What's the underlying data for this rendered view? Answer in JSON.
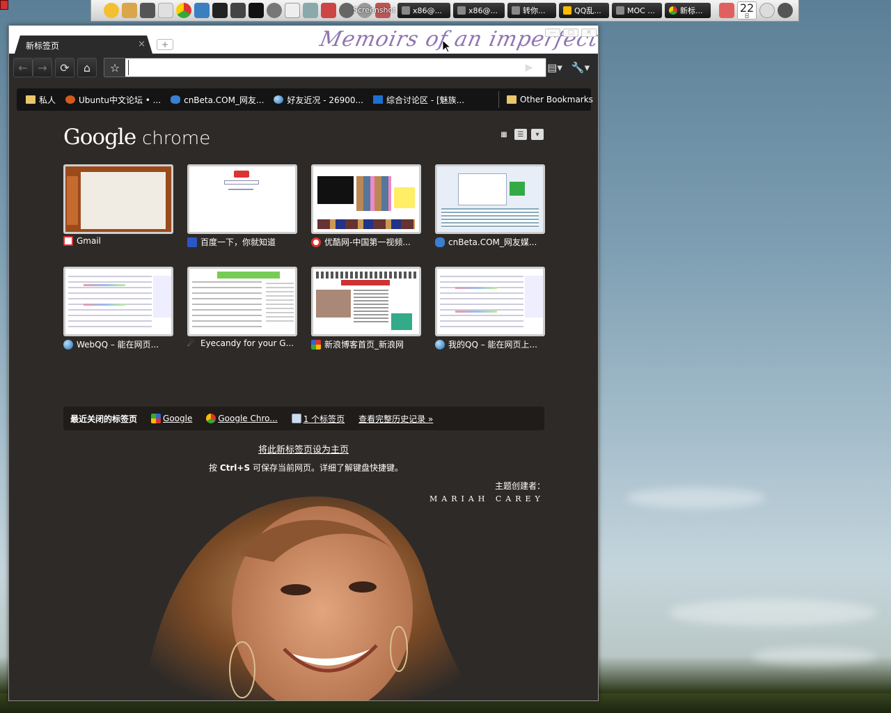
{
  "desktop": {
    "panel": {
      "screenshot_label": "Screenshot",
      "tasks": [
        {
          "label": "x86@..."
        },
        {
          "label": "x86@..."
        },
        {
          "label": "转你..."
        },
        {
          "label": "QQ乱..."
        },
        {
          "label": "MOC ..."
        },
        {
          "label": "新标..."
        }
      ],
      "clock_day": "22",
      "clock_unit": "日"
    }
  },
  "browser": {
    "tab_title": "新标签页",
    "tab_close": "×",
    "newtab_symbol": "+",
    "theme_script": "Memoirs of an imperfect",
    "address_value": "",
    "bookmarks": [
      {
        "label": "私人",
        "icon": "folder-icon"
      },
      {
        "label": "Ubuntu中文论坛 • ...",
        "icon": "ubuntu-icon"
      },
      {
        "label": "cnBeta.COM_网友...",
        "icon": "cnbeta-icon"
      },
      {
        "label": "好友近况 - 26900...",
        "icon": "globe-icon"
      },
      {
        "label": "综合讨论区 - [魅族...",
        "icon": "meizu-icon"
      }
    ],
    "other_bookmarks": "Other Bookmarks",
    "logo_google": "Google",
    "logo_chrome": "chrome",
    "thumbnails": [
      {
        "title": "Gmail",
        "icon": "gmail-icon"
      },
      {
        "title": "百度一下，你就知道",
        "icon": "baidu-icon"
      },
      {
        "title": "优酷网-中国第一视频...",
        "icon": "youku-icon"
      },
      {
        "title": "cnBeta.COM_网友媒...",
        "icon": "cnbeta-icon"
      },
      {
        "title": "WebQQ – 能在网页...",
        "icon": "globe-icon"
      },
      {
        "title": "Eyecandy for your G...",
        "icon": "eyecandy-icon"
      },
      {
        "title": "新浪博客首页_新浪网",
        "icon": "sina-icon"
      },
      {
        "title": "我的QQ – 能在网页上...",
        "icon": "globe-icon"
      }
    ],
    "recent": {
      "label": "最近关闭的标签页",
      "items": [
        {
          "label": "Google",
          "icon": "google-icon"
        },
        {
          "label": "Google Chro...",
          "icon": "chrome-icon"
        },
        {
          "label": "1 个标签页",
          "icon": "window-icon"
        }
      ],
      "history": "查看完整历史记录 »"
    },
    "set_homepage": "将此新标签页设为主页",
    "shortcut_prefix": "按",
    "shortcut_key": "Ctrl+S",
    "shortcut_rest": "可保存当前网页。详细了解键盘快捷键。",
    "theme_creator": "主题创建者：",
    "theme_artist": "MARIAH CAREY"
  },
  "colors": {
    "chrome_dark": "#2b2b2b",
    "page_bg": "#2e2a27",
    "accent_script": "#8e75b3"
  }
}
